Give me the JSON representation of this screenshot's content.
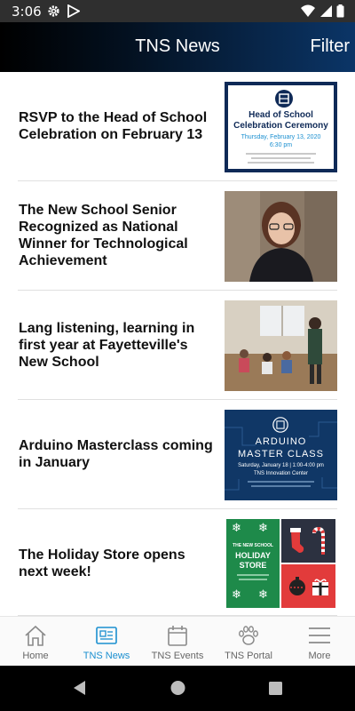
{
  "status_bar": {
    "time": "3:06",
    "icons": [
      "gear-icon",
      "play-store-icon",
      "wifi-icon",
      "signal-icon",
      "battery-icon"
    ]
  },
  "app_bar": {
    "title": "TNS News",
    "filter_label": "Filter"
  },
  "news": [
    {
      "title": "RSVP to the Head of School Celebration on February 13",
      "thumb": {
        "heading_line1": "Head of School",
        "heading_line2": "Celebration Ceremony",
        "date_line": "Thursday, February 13, 2020",
        "time_line": "6:30 pm"
      }
    },
    {
      "title": "The New School Senior Recognized as National Winner for Technological Achievement"
    },
    {
      "title": "Lang listening, learning in first year at Fayetteville's New School"
    },
    {
      "title": "Arduino Masterclass coming in January",
      "thumb": {
        "line1": "ARDUINO",
        "line2": "MASTER CLASS",
        "date_line": "Saturday, January 18 | 1:00-4:00 pm",
        "place_line": "TNS Innovation Center"
      }
    },
    {
      "title": "The Holiday Store opens next week!",
      "thumb": {
        "small": "THE NEW SCHOOL",
        "line1": "HOLIDAY",
        "line2": "STORE"
      }
    }
  ],
  "bottom_nav": [
    {
      "label": "Home",
      "icon": "home-icon",
      "active": false
    },
    {
      "label": "TNS News",
      "icon": "news-icon",
      "active": true
    },
    {
      "label": "TNS Events",
      "icon": "calendar-icon",
      "active": false
    },
    {
      "label": "TNS Portal",
      "icon": "paw-icon",
      "active": false
    },
    {
      "label": "More",
      "icon": "menu-icon",
      "active": false
    }
  ],
  "colors": {
    "accent": "#1a8fd0",
    "app_bar_start": "#000000",
    "app_bar_end": "#0b3567",
    "status_bar": "#2f2f2f",
    "holiday_green": "#1e8a4a",
    "holiday_red": "#e23b3b",
    "arduino_blue": "#103766"
  }
}
